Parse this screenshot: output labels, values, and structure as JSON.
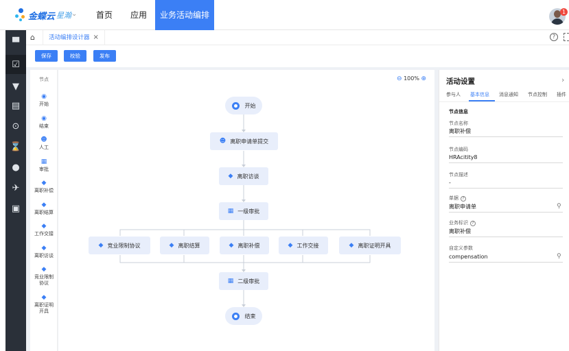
{
  "brand": {
    "name": "金蝶云",
    "product": "星瀚"
  },
  "nav": {
    "items": [
      {
        "label": "首页"
      },
      {
        "label": "应用"
      },
      {
        "label": "业务活动编排"
      }
    ]
  },
  "notification": {
    "badge": "1"
  },
  "sidebar": {
    "icons": [
      "building-icon",
      "checkbox-icon",
      "cart-icon",
      "archive-icon",
      "broadcast-icon",
      "hourglass-icon",
      "user-settings-icon",
      "plane-icon",
      "clipboard-icon"
    ]
  },
  "tabbar": {
    "tab_label": "活动编排设计器"
  },
  "toolbar": {
    "save": "保存",
    "validate": "校验",
    "publish": "发布"
  },
  "palette": {
    "title": "节点",
    "items": [
      {
        "label": "开始",
        "icon": "circle-icon"
      },
      {
        "label": "结束",
        "icon": "circle-icon"
      },
      {
        "label": "人工",
        "icon": "person-icon"
      },
      {
        "label": "审批",
        "icon": "approval-doc-icon"
      },
      {
        "label": "离职补偿",
        "icon": "tag-icon"
      },
      {
        "label": "离职结算",
        "icon": "tag-icon"
      },
      {
        "label": "工作交接",
        "icon": "tag-icon"
      },
      {
        "label": "离职访谈",
        "icon": "tag-icon"
      },
      {
        "label": "竞业限制协议",
        "icon": "tag-icon"
      },
      {
        "label": "离职证明开具",
        "icon": "tag-icon"
      }
    ]
  },
  "canvas": {
    "zoom": "100%",
    "nodes": {
      "start": "开始",
      "submit": "离职申请单提交",
      "interview": "离职访谈",
      "level1": "一级审批",
      "branches": [
        "竞业限制协议",
        "离职结算",
        "离职补偿",
        "工作交接",
        "离职证明开具"
      ],
      "level2": "二级审批",
      "end": "结束"
    }
  },
  "panel": {
    "title": "活动设置",
    "tabs": [
      "参与人",
      "基本信息",
      "消息通知",
      "节点控制",
      "插件"
    ],
    "active_tab": 1,
    "section_title": "节点信息",
    "fields": {
      "name_label": "节点名称",
      "name_value": "离职补偿",
      "code_label": "节点编码",
      "code_value": "HRAcitity8",
      "desc_label": "节点描述",
      "desc_value": "-",
      "form_label": "单据",
      "form_value": "离职申请单",
      "biz_label": "业务标识",
      "biz_value": "离职补偿",
      "param_label": "自定义参数",
      "param_value": "compensation"
    }
  }
}
